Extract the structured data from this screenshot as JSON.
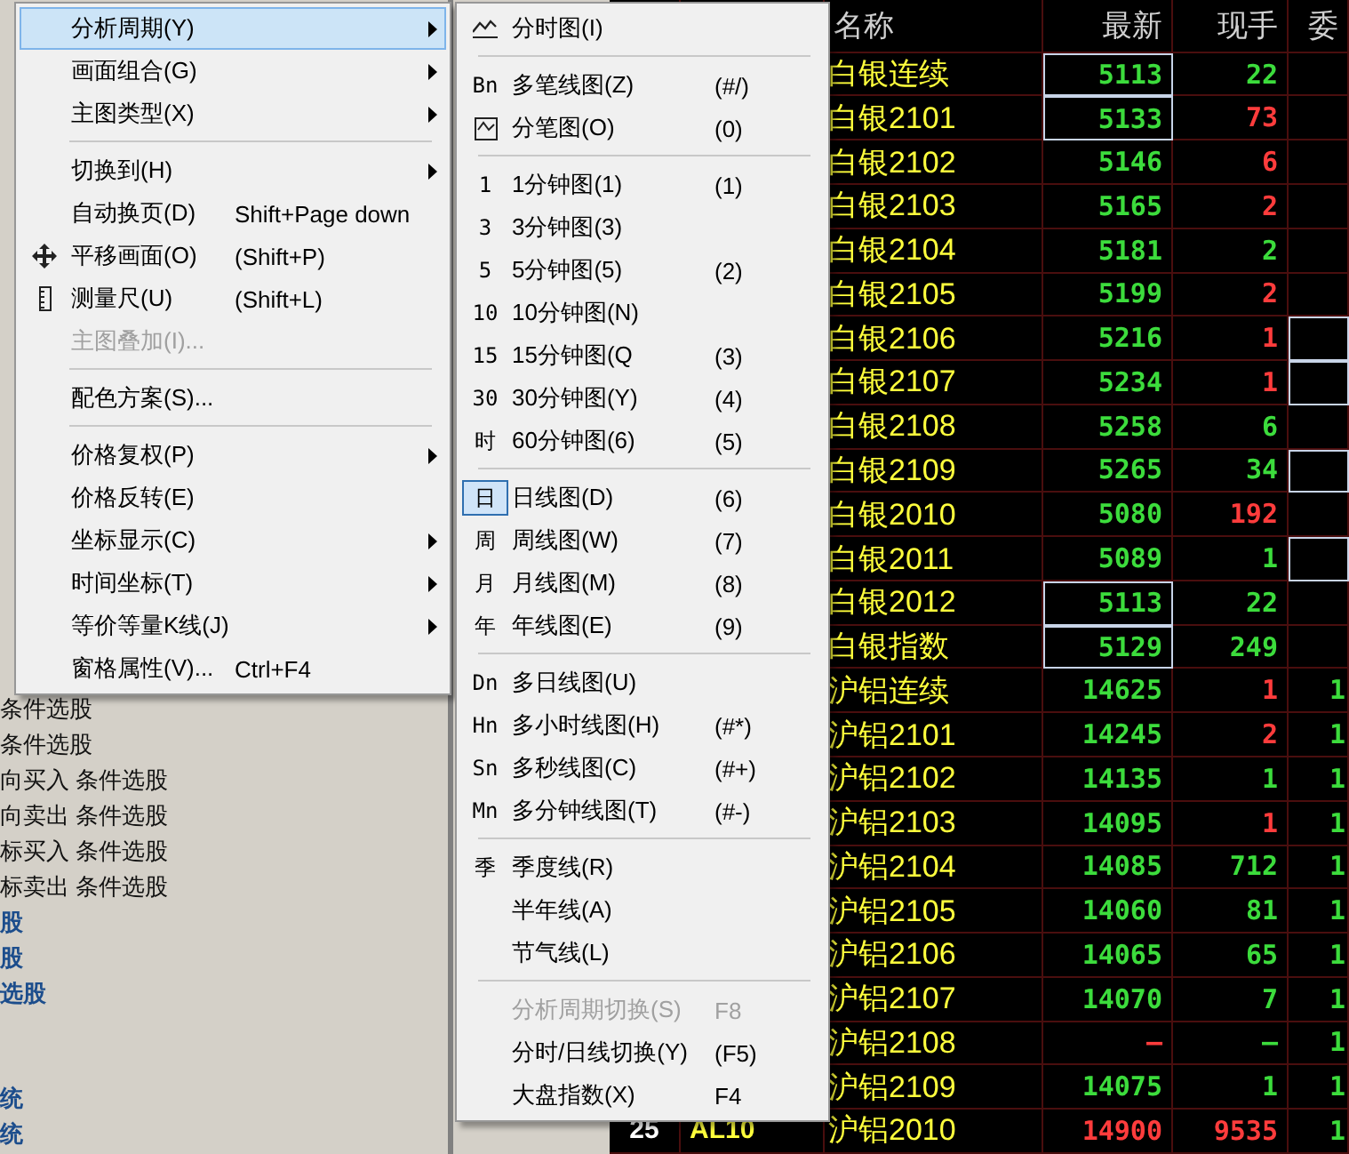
{
  "main_menu": {
    "items": [
      {
        "kind": "item",
        "label": "分析周期(Y)",
        "submenu": true,
        "selected": true,
        "disabled": false
      },
      {
        "kind": "item",
        "label": "画面组合(G)",
        "submenu": true,
        "selected": false,
        "disabled": false
      },
      {
        "kind": "item",
        "label": "主图类型(X)",
        "submenu": true,
        "selected": false,
        "disabled": false
      },
      {
        "kind": "separator"
      },
      {
        "kind": "item",
        "label": "切换到(H)",
        "submenu": true,
        "selected": false,
        "disabled": false
      },
      {
        "kind": "item",
        "label": "自动换页(D)",
        "shortcut": "Shift+Page down",
        "submenu": false,
        "selected": false,
        "disabled": false
      },
      {
        "kind": "move",
        "label": "平移画面(O)",
        "shortcut": "(Shift+P)",
        "submenu": false,
        "selected": false,
        "disabled": false
      },
      {
        "kind": "ruler",
        "label": "测量尺(U)",
        "shortcut": "(Shift+L)",
        "submenu": false,
        "selected": false,
        "disabled": false
      },
      {
        "kind": "item",
        "label": "主图叠加(I)...",
        "submenu": false,
        "selected": false,
        "disabled": true
      },
      {
        "kind": "separator"
      },
      {
        "kind": "item",
        "label": "配色方案(S)...",
        "submenu": false,
        "selected": false,
        "disabled": false
      },
      {
        "kind": "separator"
      },
      {
        "kind": "item",
        "label": "价格复权(P)",
        "submenu": true,
        "selected": false,
        "disabled": false
      },
      {
        "kind": "item",
        "label": "价格反转(E)",
        "submenu": false,
        "selected": false,
        "disabled": false
      },
      {
        "kind": "item",
        "label": "坐标显示(C)",
        "submenu": true,
        "selected": false,
        "disabled": false
      },
      {
        "kind": "item",
        "label": "时间坐标(T)",
        "submenu": true,
        "selected": false,
        "disabled": false
      },
      {
        "kind": "item",
        "label": "等价等量K线(J)",
        "submenu": true,
        "selected": false,
        "disabled": false
      },
      {
        "kind": "item",
        "label": "窗格属性(V)...",
        "shortcut": "Ctrl+F4",
        "submenu": false,
        "selected": false,
        "disabled": false
      }
    ]
  },
  "period_submenu": {
    "items": [
      {
        "kind": "chart",
        "label": "分时图(I)",
        "checked": false,
        "disabled": false
      },
      {
        "kind": "separator"
      },
      {
        "kind": "item",
        "label": "多笔线图(Z)",
        "glyph": "Bn",
        "shortcut": "(#/)",
        "checked": false,
        "disabled": false
      },
      {
        "kind": "framed",
        "label": "分笔图(O)",
        "shortcut": "(0)",
        "checked": false,
        "disabled": false
      },
      {
        "kind": "separator"
      },
      {
        "kind": "item",
        "label": "1分钟图(1)",
        "glyph": "1",
        "shortcut": "(1)",
        "checked": false,
        "disabled": false
      },
      {
        "kind": "item",
        "label": "3分钟图(3)",
        "glyph": "3",
        "checked": false,
        "disabled": false
      },
      {
        "kind": "item",
        "label": "5分钟图(5)",
        "glyph": "5",
        "shortcut": "(2)",
        "checked": false,
        "disabled": false
      },
      {
        "kind": "item",
        "label": "10分钟图(N)",
        "glyph": "10",
        "checked": false,
        "disabled": false
      },
      {
        "kind": "item",
        "label": "15分钟图(Q",
        "glyph": "15",
        "shortcut": "(3)",
        "checked": false,
        "disabled": false
      },
      {
        "kind": "item",
        "label": "30分钟图(Y)",
        "glyph": "30",
        "shortcut": "(4)",
        "checked": false,
        "disabled": false
      },
      {
        "kind": "item",
        "label": "60分钟图(6)",
        "glyph": "时",
        "shortcut": "(5)",
        "checked": false,
        "disabled": false
      },
      {
        "kind": "separator"
      },
      {
        "kind": "item",
        "label": "日线图(D)",
        "glyph": "日",
        "shortcut": "(6)",
        "checked": true,
        "disabled": false
      },
      {
        "kind": "item",
        "label": "周线图(W)",
        "glyph": "周",
        "shortcut": "(7)",
        "checked": false,
        "disabled": false
      },
      {
        "kind": "item",
        "label": "月线图(M)",
        "glyph": "月",
        "shortcut": "(8)",
        "checked": false,
        "disabled": false
      },
      {
        "kind": "item",
        "label": "年线图(E)",
        "glyph": "年",
        "shortcut": "(9)",
        "checked": false,
        "disabled": false
      },
      {
        "kind": "separator"
      },
      {
        "kind": "item",
        "label": "多日线图(U)",
        "glyph": "Dn",
        "checked": false,
        "disabled": false
      },
      {
        "kind": "item",
        "label": "多小时线图(H)",
        "glyph": "Hn",
        "shortcut": "(#*)",
        "checked": false,
        "disabled": false
      },
      {
        "kind": "item",
        "label": "多秒线图(C)",
        "glyph": "Sn",
        "shortcut": "(#+)",
        "checked": false,
        "disabled": false
      },
      {
        "kind": "item",
        "label": "多分钟线图(T)",
        "glyph": "Mn",
        "shortcut": "(#-)",
        "checked": false,
        "disabled": false
      },
      {
        "kind": "separator"
      },
      {
        "kind": "item",
        "label": "季度线(R)",
        "glyph": "季",
        "checked": false,
        "disabled": false
      },
      {
        "kind": "item",
        "label": "半年线(A)",
        "checked": false,
        "disabled": false
      },
      {
        "kind": "item",
        "label": "节气线(L)",
        "checked": false,
        "disabled": false
      },
      {
        "kind": "separator"
      },
      {
        "kind": "item",
        "label": "分析周期切换(S)",
        "shortcut": "F8",
        "checked": false,
        "disabled": true
      },
      {
        "kind": "item",
        "label": "分时/日线切换(Y)",
        "shortcut": "(F5)",
        "checked": false,
        "disabled": false
      },
      {
        "kind": "item",
        "label": "大盘指数(X)",
        "shortcut": "F4",
        "checked": false,
        "disabled": false
      }
    ]
  },
  "left_panel": {
    "sections": [
      {
        "items": [
          {
            "text": "条件选股",
            "kind": "item"
          },
          {
            "text": "条件选股",
            "kind": "item"
          },
          {
            "text": "向买入 条件选股",
            "kind": "item"
          },
          {
            "text": "向卖出 条件选股",
            "kind": "item"
          },
          {
            "text": "标买入 条件选股",
            "kind": "item"
          },
          {
            "text": "标卖出 条件选股",
            "kind": "item"
          },
          {
            "text": "股",
            "kind": "group"
          },
          {
            "text": "股",
            "kind": "group"
          },
          {
            "text": "选股",
            "kind": "group"
          }
        ]
      },
      {
        "items": [
          {
            "text": "统",
            "kind": "group"
          },
          {
            "text": "统",
            "kind": "group"
          }
        ]
      }
    ]
  },
  "quote_table": {
    "columns": [
      "名称",
      "最新",
      "现手",
      "委"
    ],
    "rows": [
      {
        "name": "白银连续",
        "latest": "5113",
        "latest_rise": false,
        "latest_framed": true,
        "volume": "22",
        "volume_rise": false,
        "col_4_framed": false
      },
      {
        "name": "白银2101",
        "latest": "5133",
        "latest_rise": false,
        "latest_framed": true,
        "volume": "73",
        "volume_rise": true,
        "col_4_framed": false
      },
      {
        "name": "白银2102",
        "latest": "5146",
        "latest_rise": false,
        "latest_framed": false,
        "volume": "6",
        "volume_rise": true,
        "col_4_framed": false
      },
      {
        "name": "白银2103",
        "latest": "5165",
        "latest_rise": false,
        "latest_framed": false,
        "volume": "2",
        "volume_rise": true,
        "col_4_framed": false
      },
      {
        "name": "白银2104",
        "latest": "5181",
        "latest_rise": false,
        "latest_framed": false,
        "volume": "2",
        "volume_rise": false,
        "col_4_framed": false
      },
      {
        "name": "白银2105",
        "latest": "5199",
        "latest_rise": false,
        "latest_framed": false,
        "volume": "2",
        "volume_rise": true,
        "col_4_framed": false
      },
      {
        "name": "白银2106",
        "latest": "5216",
        "latest_rise": false,
        "latest_framed": false,
        "volume": "1",
        "volume_rise": true,
        "col_4_framed": true
      },
      {
        "name": "白银2107",
        "latest": "5234",
        "latest_rise": false,
        "latest_framed": false,
        "volume": "1",
        "volume_rise": true,
        "col_4_framed": true
      },
      {
        "name": "白银2108",
        "latest": "5258",
        "latest_rise": false,
        "latest_framed": false,
        "volume": "6",
        "volume_rise": false,
        "col_4_framed": false
      },
      {
        "name": "白银2109",
        "latest": "5265",
        "latest_rise": false,
        "latest_framed": false,
        "volume": "34",
        "volume_rise": false,
        "col_4_framed": true
      },
      {
        "name": "白银2010",
        "latest": "5080",
        "latest_rise": false,
        "latest_framed": false,
        "volume": "192",
        "volume_rise": true,
        "col_4_framed": false
      },
      {
        "name": "白银2011",
        "latest": "5089",
        "latest_rise": false,
        "latest_framed": false,
        "volume": "1",
        "volume_rise": false,
        "col_4_framed": true
      },
      {
        "name": "白银2012",
        "latest": "5113",
        "latest_rise": false,
        "latest_framed": true,
        "volume": "22",
        "volume_rise": false,
        "col_4_framed": false
      },
      {
        "name": "白银指数",
        "latest": "5129",
        "latest_rise": false,
        "latest_framed": true,
        "volume": "249",
        "volume_rise": false,
        "col_4_framed": false
      },
      {
        "name": "沪铝连续",
        "latest": "14625",
        "latest_rise": false,
        "latest_framed": false,
        "volume": "1",
        "volume_rise": true,
        "col_4": "1",
        "col_4_framed": false
      },
      {
        "name": "沪铝2101",
        "latest": "14245",
        "latest_rise": false,
        "latest_framed": false,
        "volume": "2",
        "volume_rise": true,
        "col_4": "1",
        "col_4_framed": false
      },
      {
        "name": "沪铝2102",
        "latest": "14135",
        "latest_rise": false,
        "latest_framed": false,
        "volume": "1",
        "volume_rise": false,
        "col_4": "1",
        "col_4_framed": false
      },
      {
        "name": "沪铝2103",
        "latest": "14095",
        "latest_rise": false,
        "latest_framed": false,
        "volume": "1",
        "volume_rise": true,
        "col_4": "1",
        "col_4_framed": false
      },
      {
        "name": "沪铝2104",
        "latest": "14085",
        "latest_rise": false,
        "latest_framed": false,
        "volume": "712",
        "volume_rise": false,
        "col_4": "1",
        "col_4_framed": false
      },
      {
        "name": "沪铝2105",
        "latest": "14060",
        "latest_rise": false,
        "latest_framed": false,
        "volume": "81",
        "volume_rise": false,
        "col_4": "1",
        "col_4_framed": false
      },
      {
        "name": "沪铝2106",
        "latest": "14065",
        "latest_rise": false,
        "latest_framed": false,
        "volume": "65",
        "volume_rise": false,
        "col_4": "1",
        "col_4_framed": false
      },
      {
        "name": "沪铝2107",
        "latest": "14070",
        "latest_rise": false,
        "latest_framed": false,
        "volume": "7",
        "volume_rise": false,
        "col_4": "1",
        "col_4_framed": false
      },
      {
        "name": "沪铝2108",
        "latest": "—",
        "latest_rise": true,
        "latest_framed": false,
        "volume": "—",
        "volume_rise": false,
        "col_4": "1",
        "col_4_framed": false
      },
      {
        "name": "沪铝2109",
        "latest": "14075",
        "latest_rise": false,
        "latest_framed": false,
        "volume": "1",
        "volume_rise": false,
        "col_4": "1",
        "col_4_framed": false
      },
      {
        "number": "25",
        "code": "AL10",
        "name": "沪铝2010",
        "latest": "14900",
        "latest_rise": true,
        "latest_framed": false,
        "volume": "9535",
        "volume_rise": true,
        "col_4": "1",
        "col_4_framed": false
      }
    ]
  }
}
